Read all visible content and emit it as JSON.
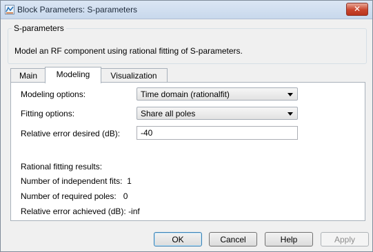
{
  "window": {
    "title": "Block Parameters: S-parameters",
    "close_glyph": "✕"
  },
  "group": {
    "legend": "S-parameters",
    "description": "Model an RF component using rational fitting of S-parameters."
  },
  "tabs": [
    {
      "label": "Main"
    },
    {
      "label": "Modeling"
    },
    {
      "label": "Visualization"
    }
  ],
  "active_tab": "Modeling",
  "modeling": {
    "modeling_options_label": "Modeling options:",
    "modeling_options_value": "Time domain (rationalfit)",
    "fitting_options_label": "Fitting options:",
    "fitting_options_value": "Share all poles",
    "relative_error_label": "Relative error desired (dB):",
    "relative_error_value": "-40",
    "results_heading": "Rational fitting results:",
    "independent_fits": "Number of independent fits:  1",
    "required_poles": "Number of required poles:   0",
    "error_achieved": "Relative error achieved (dB): -inf"
  },
  "buttons": {
    "ok": "OK",
    "cancel": "Cancel",
    "help": "Help",
    "apply": "Apply"
  },
  "colors": {
    "close_button": "#c9442c",
    "default_button_border": "#3c7fb1"
  }
}
